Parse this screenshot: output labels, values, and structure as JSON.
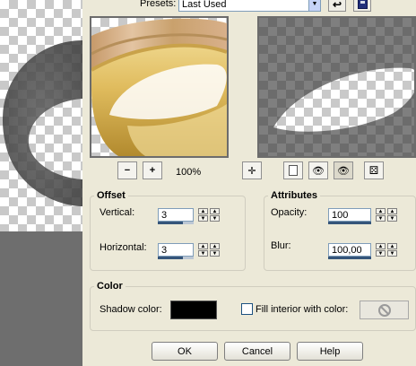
{
  "header": {
    "presets_label": "Presets:",
    "presets_value": "Last Used"
  },
  "toolbar": {
    "zoom_level": "100%"
  },
  "offset": {
    "title": "Offset",
    "vertical_label": "Vertical:",
    "vertical_value": "3",
    "horizontal_label": "Horizontal:",
    "horizontal_value": "3"
  },
  "attributes": {
    "title": "Attributes",
    "opacity_label": "Opacity:",
    "opacity_value": "100",
    "blur_label": "Blur:",
    "blur_value": "100,00"
  },
  "color": {
    "title": "Color",
    "shadow_label": "Shadow color:",
    "shadow_color": "#000000",
    "fill_label": "Fill interior with color:"
  },
  "buttons": {
    "ok": "OK",
    "cancel": "Cancel",
    "help": "Help"
  }
}
